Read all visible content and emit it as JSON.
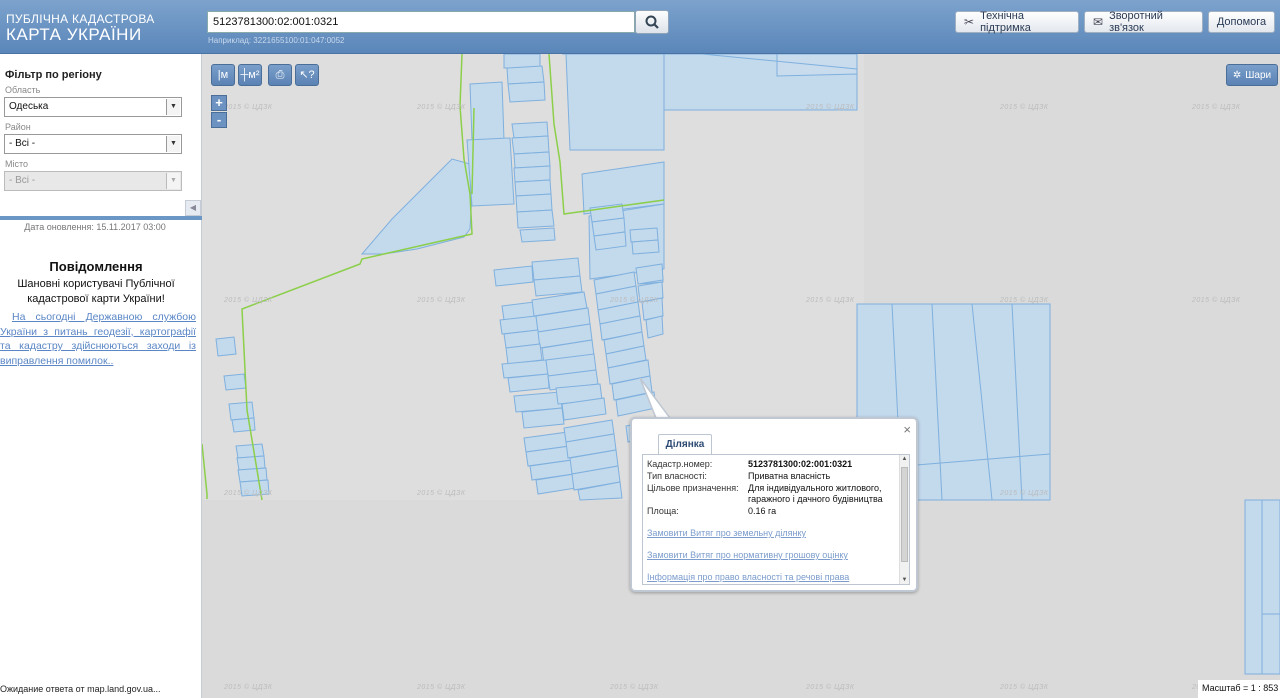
{
  "header": {
    "logo_line1": "ПУБЛІЧНА КАДАСТРОВА",
    "logo_line2": "КАРТА УКРАЇНИ",
    "search_value": "5123781300:02:001:0321",
    "search_hint": "Наприклад: 3221655100:01:047:0052",
    "support_label": "Технічна підтримка",
    "feedback_label": "Зворотний зв'язок",
    "help_label": "Допомога"
  },
  "sidebar": {
    "filter_title": "Фільтр по регіону",
    "region_label": "Область",
    "region_value": "Одеська",
    "district_label": "Район",
    "district_value": "- Всі -",
    "city_label": "Місто",
    "city_value": "- Всі -",
    "update_date": "Дата оновлення: 15.11.2017 03:00",
    "message_title": "Повідомлення",
    "message_greeting": "Шановні користувачі Публічної кадастрової карти України!",
    "message_link": "На сьогодні Державною службою України з питань геодезії, картографії та кадастру здійснюються заходи із виправлення помилок..",
    "status_text": "Ожидание ответа от map.land.gov.ua..."
  },
  "map": {
    "layers_label": "Шари",
    "scale_text": "Масштаб = 1 : 853",
    "watermark": "2015 © ЦДЗК",
    "zoom_in": "+",
    "zoom_out": "-"
  },
  "toolbar": {
    "measure_line": "|м",
    "measure_area": "┼м²",
    "print": "⎙",
    "identify": "↖?"
  },
  "popup": {
    "tab_label": "Ділянка",
    "close": "×",
    "fields": [
      {
        "key": "Кадастр.номер:",
        "value": "5123781300:02:001:0321"
      },
      {
        "key": "Тип власності:",
        "value": "Приватна власність"
      },
      {
        "key": "Цільове призначення:",
        "value": "Для індивідуального житлового, гаражного і дачного будівництва"
      },
      {
        "key": "Площа:",
        "value": "0.16 га"
      }
    ],
    "links": [
      "Замовити Витяг про земельну ділянку",
      "Замовити Витяг про нормативну грошову оцінку",
      "Інформація про право власності та речові права"
    ]
  },
  "colors": {
    "header": "#6a93c4",
    "parcel_fill": "#c3d9ec",
    "parcel_stroke": "#7fb0de",
    "boundary": "#8ccf4a"
  }
}
